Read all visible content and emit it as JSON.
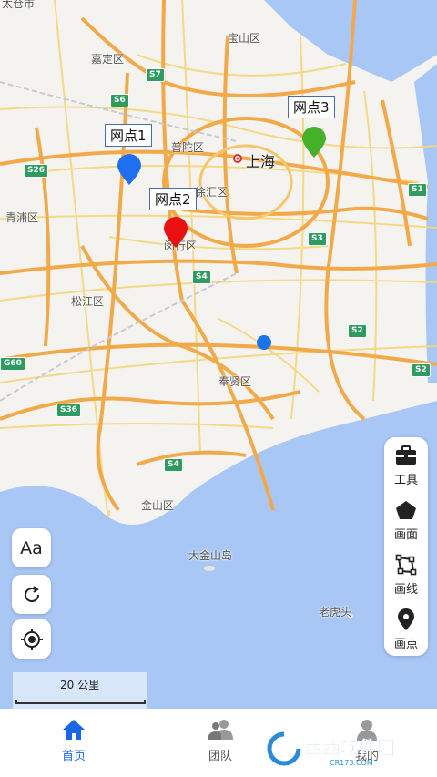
{
  "map": {
    "places": {
      "baoshan": "宝山区",
      "jiading": "嘉定区",
      "putuo": "普陀区",
      "shanghai": "上海",
      "xuhui": "徐汇区",
      "qingpu": "青浦区",
      "minhang": "闵行区",
      "songjiang": "松江区",
      "fengxian": "奉贤区",
      "jinshan": "金山区",
      "dajinshan": "大金山岛",
      "laohutou": "老虎头",
      "taicang": "太仓市"
    },
    "roads": {
      "s7": "S7",
      "s6": "S6",
      "s26": "S26",
      "s1": "S1",
      "s3": "S3",
      "s4a": "S4",
      "s2a": "S2",
      "s2b": "S2",
      "g60": "G60",
      "s36": "S36",
      "s4b": "S4"
    },
    "markers": [
      {
        "label": "网点1",
        "color": "#1f6ff0"
      },
      {
        "label": "网点2",
        "color": "#e81010"
      },
      {
        "label": "网点3",
        "color": "#45b12a"
      }
    ],
    "location_dot_color": "#1a73e8"
  },
  "left_controls": {
    "font_glyph": "Aa",
    "refresh_icon": "refresh-icon",
    "locate_icon": "locate-icon"
  },
  "toolbar": {
    "items": [
      {
        "label": "工具",
        "icon": "toolbox-icon"
      },
      {
        "label": "画面",
        "icon": "pentagon-icon"
      },
      {
        "label": "画线",
        "icon": "polyline-icon"
      },
      {
        "label": "画点",
        "icon": "map-pin-icon"
      }
    ]
  },
  "scale": {
    "text": "20 公里"
  },
  "tabbar": {
    "tabs": [
      {
        "label": "首页",
        "icon": "home-icon",
        "active": true
      },
      {
        "label": "团队",
        "icon": "team-icon",
        "active": false
      },
      {
        "label": "我的",
        "icon": "user-icon",
        "active": false
      }
    ],
    "active_color": "#1a66e8"
  },
  "watermark": {
    "text": "西西软件园",
    "sub": "CR173.COM"
  }
}
